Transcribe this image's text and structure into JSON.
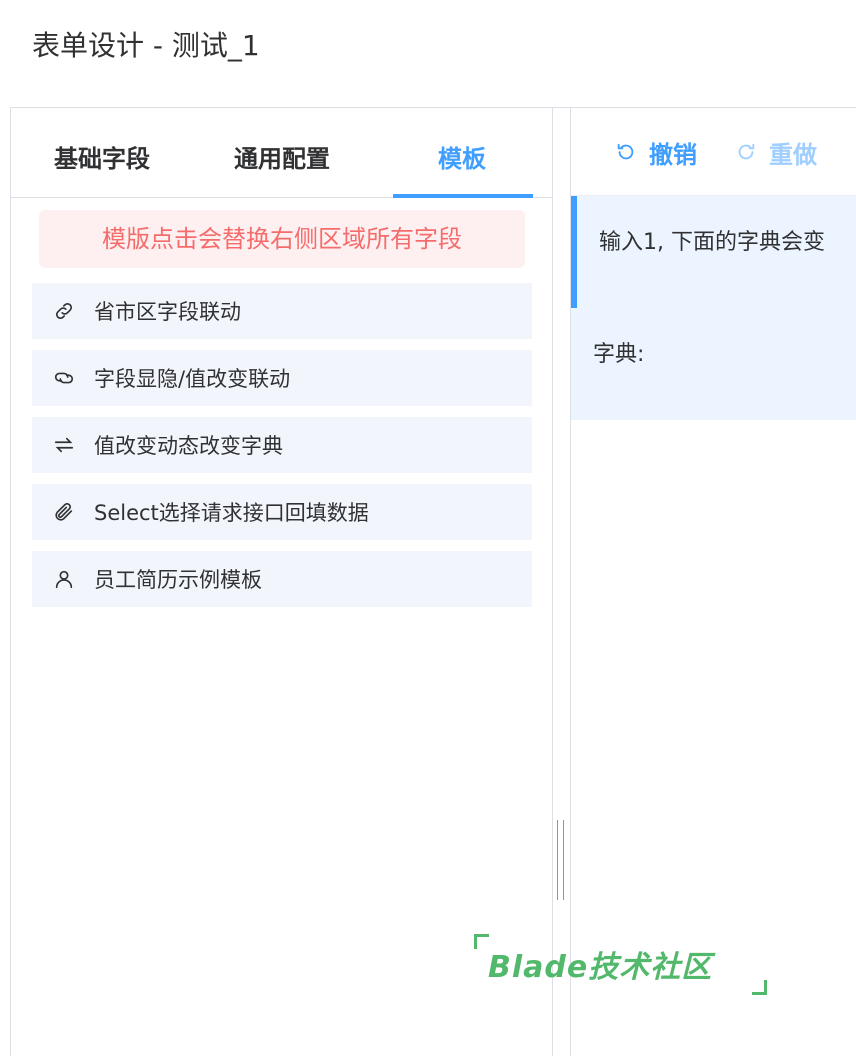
{
  "page": {
    "title": "表单设计 - 测试_1"
  },
  "left_panel": {
    "tabs": [
      {
        "label": "基础字段",
        "active": false
      },
      {
        "label": "通用配置",
        "active": false
      },
      {
        "label": "模板",
        "active": true
      }
    ],
    "notice": "模版点击会替换右侧区域所有字段",
    "templates": [
      {
        "label": "省市区字段联动",
        "icon": "link-icon"
      },
      {
        "label": "字段显隐/值改变联动",
        "icon": "copy-link-icon"
      },
      {
        "label": "值改变动态改变字典",
        "icon": "switch-icon"
      },
      {
        "label": "Select选择请求接口回填数据",
        "icon": "paperclip-icon"
      },
      {
        "label": "员工简历示例模板",
        "icon": "user-icon"
      }
    ]
  },
  "right_panel": {
    "toolbar": {
      "undo_label": "撤销",
      "redo_label": "重做"
    },
    "alert_text": "输入1, 下面的字典会变",
    "field_label": "字典:"
  },
  "watermark": {
    "text": "Blade技术社区"
  },
  "colors": {
    "accent": "#409eff",
    "danger": "#f56c6c",
    "danger_bg": "#fef0f0",
    "item_bg": "#f2f6fc",
    "canvas_bg": "#ecf5ff",
    "watermark": "#52b86b"
  }
}
